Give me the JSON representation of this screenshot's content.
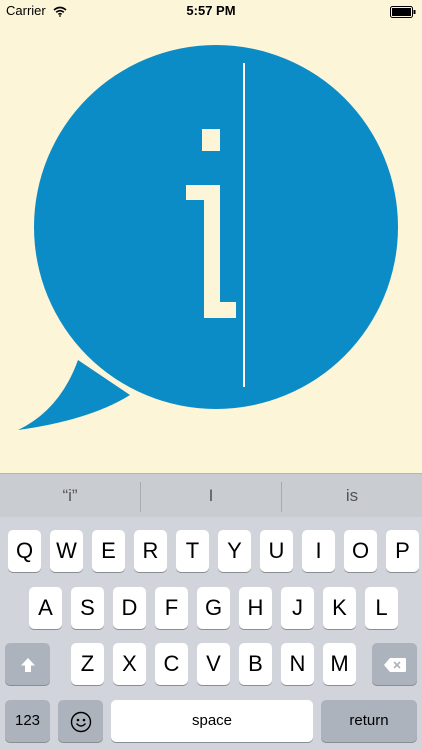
{
  "status_bar": {
    "carrier": "Carrier",
    "time": "5:57 PM"
  },
  "colors": {
    "background": "#FDF5D8",
    "bubble": "#0B8CC6",
    "glyph": "#FDF5D8",
    "keyboard": "#D1D5DB"
  },
  "icons": {
    "wifi": "wifi-icon",
    "battery": "battery-icon",
    "shift": "shift-icon",
    "delete": "backspace-icon",
    "emoji": "emoji-icon"
  },
  "suggestions": [
    "“i”",
    "I",
    "is"
  ],
  "keyboard": {
    "row1": [
      "Q",
      "W",
      "E",
      "R",
      "T",
      "Y",
      "U",
      "I",
      "O",
      "P"
    ],
    "row2": [
      "A",
      "S",
      "D",
      "F",
      "G",
      "H",
      "J",
      "K",
      "L"
    ],
    "row3": [
      "Z",
      "X",
      "C",
      "V",
      "B",
      "N",
      "M"
    ],
    "numbers_label": "123",
    "space_label": "space",
    "return_label": "return"
  }
}
